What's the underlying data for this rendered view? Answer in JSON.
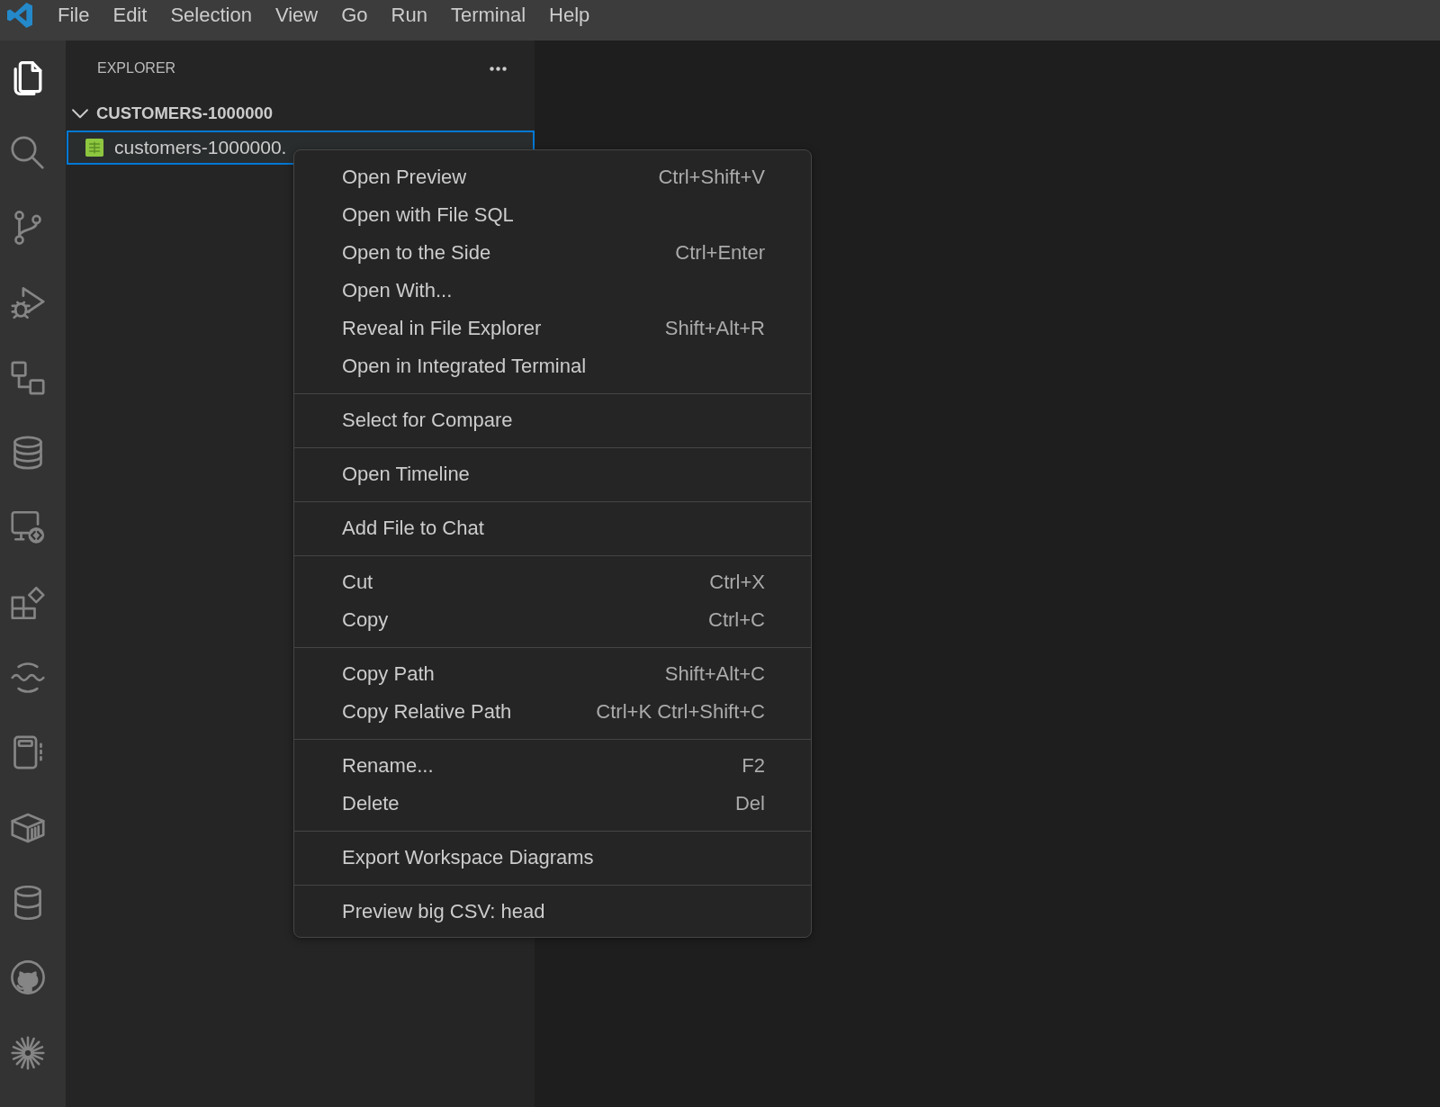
{
  "menu_bar": {
    "items": [
      "File",
      "Edit",
      "Selection",
      "View",
      "Go",
      "Run",
      "Terminal",
      "Help"
    ]
  },
  "activity_bar": [
    {
      "selected": true
    },
    {
      "selected": false
    },
    {
      "selected": false
    },
    {
      "selected": false
    },
    {
      "selected": false
    },
    {
      "selected": false
    },
    {
      "selected": false
    },
    {
      "selected": false
    },
    {
      "selected": false
    },
    {
      "selected": false
    },
    {
      "selected": false
    },
    {
      "selected": false
    },
    {
      "selected": false
    },
    {
      "selected": false
    }
  ],
  "explorer": {
    "title": "EXPLORER",
    "folder": {
      "name": "CUSTOMERS-1000000",
      "expanded": true,
      "files": [
        {
          "name": "customers-1000000.",
          "selected": true
        }
      ]
    }
  },
  "context_menu": {
    "groups": [
      [
        {
          "label": "Open Preview",
          "shortcut": "Ctrl+Shift+V"
        },
        {
          "label": "Open with File SQL"
        },
        {
          "label": "Open to the Side",
          "shortcut": "Ctrl+Enter"
        },
        {
          "label": "Open With..."
        },
        {
          "label": "Reveal in File Explorer",
          "shortcut": "Shift+Alt+R"
        },
        {
          "label": "Open in Integrated Terminal"
        }
      ],
      [
        {
          "label": "Select for Compare"
        }
      ],
      [
        {
          "label": "Open Timeline"
        }
      ],
      [
        {
          "label": "Add File to Chat"
        }
      ],
      [
        {
          "label": "Cut",
          "shortcut": "Ctrl+X"
        },
        {
          "label": "Copy",
          "shortcut": "Ctrl+C"
        }
      ],
      [
        {
          "label": "Copy Path",
          "shortcut": "Shift+Alt+C"
        },
        {
          "label": "Copy Relative Path",
          "shortcut": "Ctrl+K Ctrl+Shift+C"
        }
      ],
      [
        {
          "label": "Rename...",
          "shortcut": "F2"
        },
        {
          "label": "Delete",
          "shortcut": "Del"
        }
      ],
      [
        {
          "label": "Export Workspace Diagrams"
        }
      ],
      [
        {
          "label": "Preview big CSV: head"
        }
      ]
    ]
  }
}
